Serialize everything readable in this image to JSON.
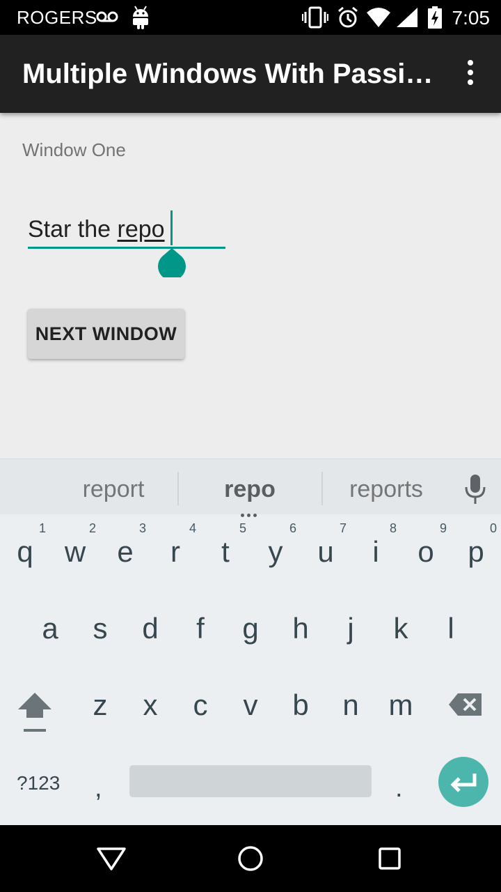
{
  "status_bar": {
    "carrier": "ROGERS",
    "time": "7:05",
    "icons": [
      "voicemail-icon",
      "android-debug-icon",
      "vibrate-icon",
      "alarm-icon",
      "wifi-icon",
      "cell-signal-icon",
      "battery-charging-icon"
    ]
  },
  "toolbar": {
    "title": "Multiple Windows With Passing Data",
    "overflow_icon": "more-vert-icon"
  },
  "content": {
    "window_label": "Window One",
    "input_prefix": "Star the ",
    "input_composing": "repo",
    "next_button_label": "NEXT WINDOW"
  },
  "keyboard": {
    "suggestions": [
      "report",
      "repo",
      "reports"
    ],
    "row1": [
      {
        "key": "q",
        "hint": "1"
      },
      {
        "key": "w",
        "hint": "2"
      },
      {
        "key": "e",
        "hint": "3"
      },
      {
        "key": "r",
        "hint": "4"
      },
      {
        "key": "t",
        "hint": "5"
      },
      {
        "key": "y",
        "hint": "6"
      },
      {
        "key": "u",
        "hint": "7"
      },
      {
        "key": "i",
        "hint": "8"
      },
      {
        "key": "o",
        "hint": "9"
      },
      {
        "key": "p",
        "hint": "0"
      }
    ],
    "row2": [
      "a",
      "s",
      "d",
      "f",
      "g",
      "h",
      "j",
      "k",
      "l"
    ],
    "row3": [
      "z",
      "x",
      "c",
      "v",
      "b",
      "n",
      "m"
    ],
    "symbols_label": "?123",
    "comma": ",",
    "period": ".",
    "accent_color": "#4db6ac"
  },
  "colors": {
    "accent": "#009688",
    "toolbar": "#212121"
  }
}
